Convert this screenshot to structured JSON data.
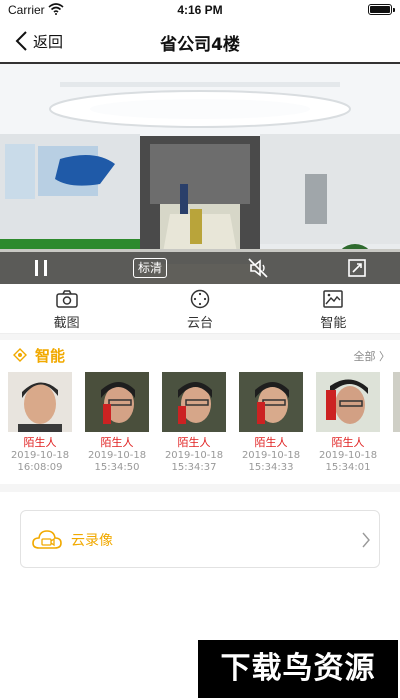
{
  "status_bar": {
    "carrier": "Carrier",
    "time": "4:16 PM"
  },
  "nav": {
    "back_label": "返回",
    "title": "省公司4楼"
  },
  "video": {
    "quality_label": "标清"
  },
  "tools": [
    {
      "label": "截图",
      "icon": "camera-icon"
    },
    {
      "label": "云台",
      "icon": "ptz-icon"
    },
    {
      "label": "智能",
      "icon": "smart-icon"
    }
  ],
  "smart": {
    "title": "智能",
    "all_label": "全部 〉",
    "events": [
      {
        "tag": "陌生人",
        "date": "2019-10-18",
        "time": "16:08:09"
      },
      {
        "tag": "陌生人",
        "date": "2019-10-18",
        "time": "15:34:50"
      },
      {
        "tag": "陌生人",
        "date": "2019-10-18",
        "time": "15:34:37"
      },
      {
        "tag": "陌生人",
        "date": "2019-10-18",
        "time": "15:34:33"
      },
      {
        "tag": "陌生人",
        "date": "2019-10-18",
        "time": "15:34:01"
      }
    ]
  },
  "cloud": {
    "label": "云录像"
  },
  "watermark": {
    "text": "下载鸟资源"
  },
  "colors": {
    "accent": "#f1a900",
    "stranger": "#e02020"
  }
}
